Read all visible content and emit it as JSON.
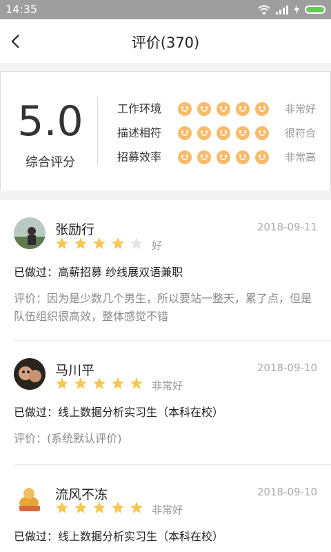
{
  "status_bar": {
    "time": "14:35",
    "battery_color": "#5bd14a"
  },
  "header": {
    "title": "评价(370)",
    "back_icon": "chevron-left-icon"
  },
  "summary": {
    "score": "5.0",
    "score_label": "综合评分",
    "face_color": "#f7bb6b",
    "metrics": [
      {
        "label": "工作环境",
        "faces": 5,
        "value": "非常好"
      },
      {
        "label": "描述相符",
        "faces": 5,
        "value": "很符合"
      },
      {
        "label": "招募效率",
        "faces": 5,
        "value": "非常高"
      }
    ]
  },
  "star_color": "#f8c751",
  "reviews": [
    {
      "name": "张励行",
      "date": "2018-09-11",
      "stars": 4,
      "rating_text": "好",
      "worked": "已做过：高薪招募 纱线展双语兼职",
      "comment": "评价：因为是少数几个男生，所以要站一整天，累了点，但是队伍组织很高效，整体感觉不错"
    },
    {
      "name": "马川平",
      "date": "2018-09-10",
      "stars": 5,
      "rating_text": "非常好",
      "worked": "已做过：线上数据分析实习生（本科在校）",
      "comment": "评价：(系统默认评价)"
    },
    {
      "name": "流风不冻",
      "date": "2018-09-10",
      "stars": 5,
      "rating_text": "非常好",
      "worked": "已做过：线上数据分析实习生（本科在校）",
      "comment": ""
    }
  ]
}
